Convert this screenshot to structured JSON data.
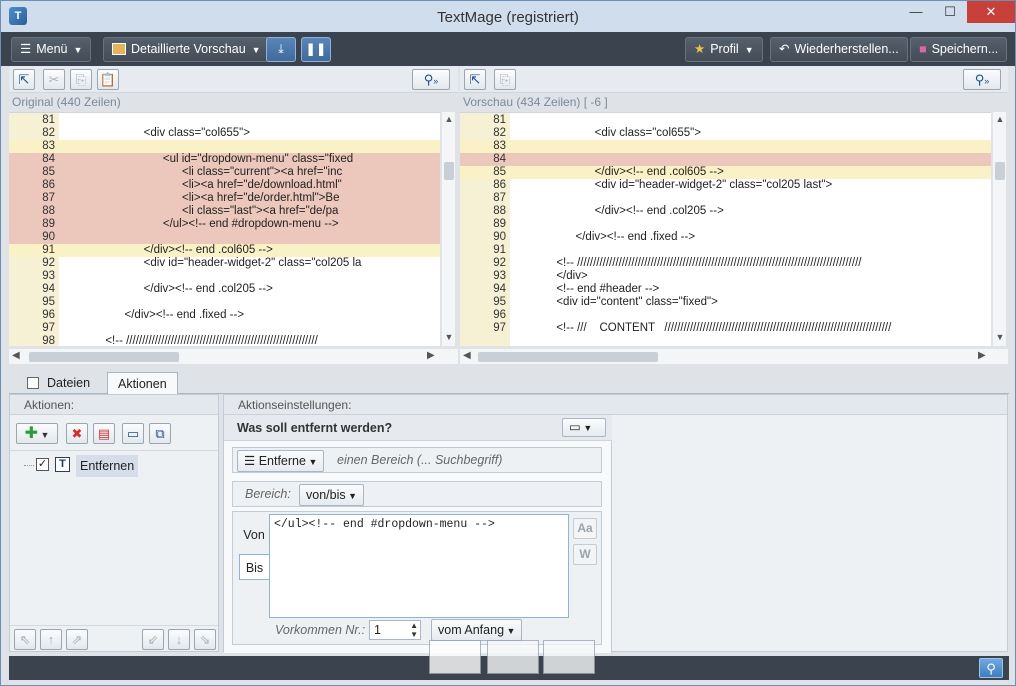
{
  "window": {
    "title": "TextMage (registriert)",
    "min": "—",
    "max": "☐",
    "close": "✕"
  },
  "toolbar": {
    "menu": "Menü",
    "preview": "Detaillierte Vorschau",
    "profile": "Profil",
    "restore": "Wiederherstellen...",
    "save": "Speichern..."
  },
  "left_pane": {
    "label": "Original (440 Zeilen)",
    "lines": [
      {
        "n": "81",
        "t": "",
        "s": "n"
      },
      {
        "n": "82",
        "t": "                        <div class=\"col655\">",
        "s": "n"
      },
      {
        "n": "83",
        "t": "",
        "s": "c"
      },
      {
        "n": "84",
        "t": "                              <ul id=\"dropdown-menu\" class=\"fixed",
        "s": "d"
      },
      {
        "n": "85",
        "t": "                                    <li class=\"current\"><a href=\"inc",
        "s": "d"
      },
      {
        "n": "86",
        "t": "                                    <li><a href=\"de/download.html\"",
        "s": "d"
      },
      {
        "n": "87",
        "t": "                                    <li><a href=\"de/order.html\">Be",
        "s": "d"
      },
      {
        "n": "88",
        "t": "                                    <li class=\"last\"><a href=\"de/pa",
        "s": "d"
      },
      {
        "n": "89",
        "t": "                              </ul><!-- end #dropdown-menu -->",
        "s": "d"
      },
      {
        "n": "90",
        "t": "",
        "s": "d"
      },
      {
        "n": "91",
        "t": "                        </div><!-- end .col605 -->",
        "s": "c"
      },
      {
        "n": "92",
        "t": "                        <div id=\"header-widget-2\" class=\"col205 la",
        "s": "n"
      },
      {
        "n": "93",
        "t": "",
        "s": "n"
      },
      {
        "n": "94",
        "t": "                        </div><!-- end .col205 -->",
        "s": "n"
      },
      {
        "n": "95",
        "t": "",
        "s": "n"
      },
      {
        "n": "96",
        "t": "                  </div><!-- end .fixed -->",
        "s": "n"
      },
      {
        "n": "97",
        "t": "",
        "s": "n"
      },
      {
        "n": "98",
        "t": "            <!-- ////////////////////////////////////////////////////////////",
        "s": "n"
      }
    ]
  },
  "right_pane": {
    "label": "Vorschau (434 Zeilen) [ -6 ]",
    "lines": [
      {
        "n": "81",
        "t": "",
        "s": "n"
      },
      {
        "n": "82",
        "t": "                        <div class=\"col655\">",
        "s": "n"
      },
      {
        "n": "83",
        "t": "",
        "s": "c"
      },
      {
        "n": "84",
        "t": "",
        "s": "d"
      },
      {
        "n": "85",
        "t": "                        </div><!-- end .col605 -->",
        "s": "c"
      },
      {
        "n": "86",
        "t": "                        <div id=\"header-widget-2\" class=\"col205 last\">",
        "s": "n"
      },
      {
        "n": "87",
        "t": "",
        "s": "n"
      },
      {
        "n": "88",
        "t": "                        </div><!-- end .col205 -->",
        "s": "n"
      },
      {
        "n": "89",
        "t": "",
        "s": "n"
      },
      {
        "n": "90",
        "t": "                  </div><!-- end .fixed -->",
        "s": "n"
      },
      {
        "n": "91",
        "t": "",
        "s": "n"
      },
      {
        "n": "92",
        "t": "            <!-- /////////////////////////////////////////////////////////////////////////////////////////",
        "s": "n"
      },
      {
        "n": "93",
        "t": "            </div>",
        "s": "n"
      },
      {
        "n": "94",
        "t": "            <!-- end #header -->",
        "s": "n"
      },
      {
        "n": "95",
        "t": "            <div id=\"content\" class=\"fixed\">",
        "s": "n"
      },
      {
        "n": "96",
        "t": "",
        "s": "n"
      },
      {
        "n": "97",
        "t": "            <!-- ///    CONTENT   ///////////////////////////////////////////////////////////////////////",
        "s": "n"
      }
    ]
  },
  "tabs": {
    "files": "Dateien",
    "actions": "Aktionen"
  },
  "actions_panel": {
    "header": "Aktionen:",
    "item": "Entfernen"
  },
  "settings": {
    "header": "Aktionseinstellungen:",
    "question": "Was soll entfernt werden?",
    "remove_mode": "Entferne",
    "remove_hint": "einen Bereich (... Suchbegriff)",
    "range_label": "Bereich:",
    "range_value": "von/bis",
    "von": "Von",
    "bis": "Bis",
    "text": "</ul><!-- end #dropdown-menu -->",
    "case_btn": "Aa",
    "word_btn": "W",
    "occurrence_label": "Vorkommen Nr.:",
    "occurrence_value": "1",
    "from_value": "vom Anfang"
  },
  "colors": {
    "changed": "#fbf1c7",
    "removed": "#ecc7bb",
    "gutter": "#f6f0d4",
    "toolbar": "#3b434e"
  }
}
